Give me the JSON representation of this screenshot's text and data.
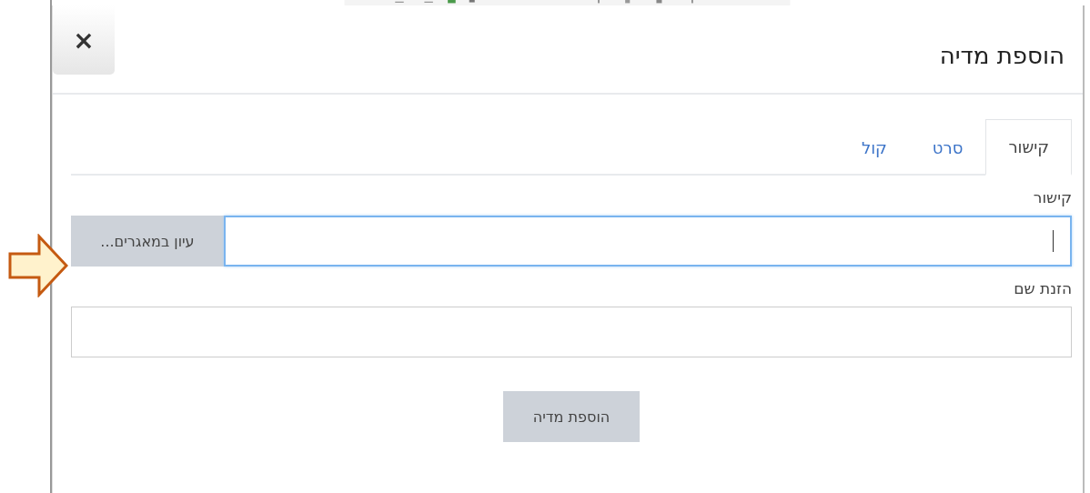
{
  "dialog": {
    "title": "הוספת מדיה",
    "close_label": "×"
  },
  "tabs": [
    {
      "label": "קישור",
      "selected": true
    },
    {
      "label": "סרט",
      "selected": false
    },
    {
      "label": "קול",
      "selected": false
    }
  ],
  "fields": [
    {
      "label": "קישור",
      "focused": true,
      "button": "עיון במאגרים..."
    },
    {
      "label": "הזנת שם",
      "focused": false
    }
  ],
  "submit": "הוספת מדיה"
}
